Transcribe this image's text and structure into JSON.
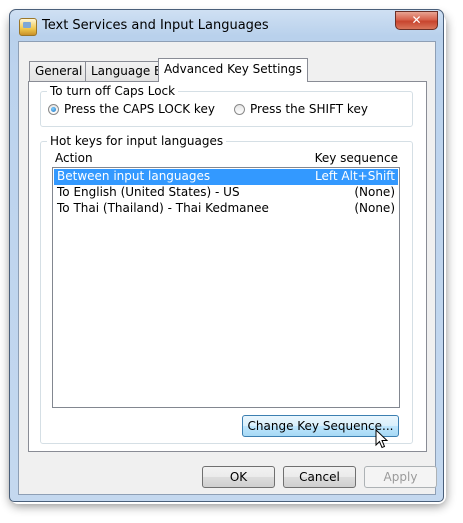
{
  "window": {
    "title": "Text Services and Input Languages",
    "close_label": "✕"
  },
  "tabs": [
    {
      "label": "General",
      "active": false
    },
    {
      "label": "Language Bar",
      "active": false
    },
    {
      "label": "Advanced Key Settings",
      "active": true
    }
  ],
  "caps_lock": {
    "group_label": "To turn off Caps Lock",
    "options": [
      {
        "label": "Press the CAPS LOCK key",
        "checked": true
      },
      {
        "label": "Press the SHIFT key",
        "checked": false
      }
    ]
  },
  "hotkeys": {
    "group_label": "Hot keys for input languages",
    "columns": [
      "Action",
      "Key sequence"
    ],
    "rows": [
      {
        "action": "Between input languages",
        "sequence": "Left Alt+Shift",
        "selected": true
      },
      {
        "action": "To English (United States) - US",
        "sequence": "(None)",
        "selected": false
      },
      {
        "action": "To Thai (Thailand) - Thai Kedmanee",
        "sequence": "(None)",
        "selected": false
      }
    ],
    "change_button": "Change Key Sequence..."
  },
  "footer": {
    "ok": "OK",
    "cancel": "Cancel",
    "apply": "Apply"
  },
  "colors": {
    "selection": "#3399ff",
    "title_bar": "#b9d1ec",
    "close_button": "#c8452e"
  }
}
